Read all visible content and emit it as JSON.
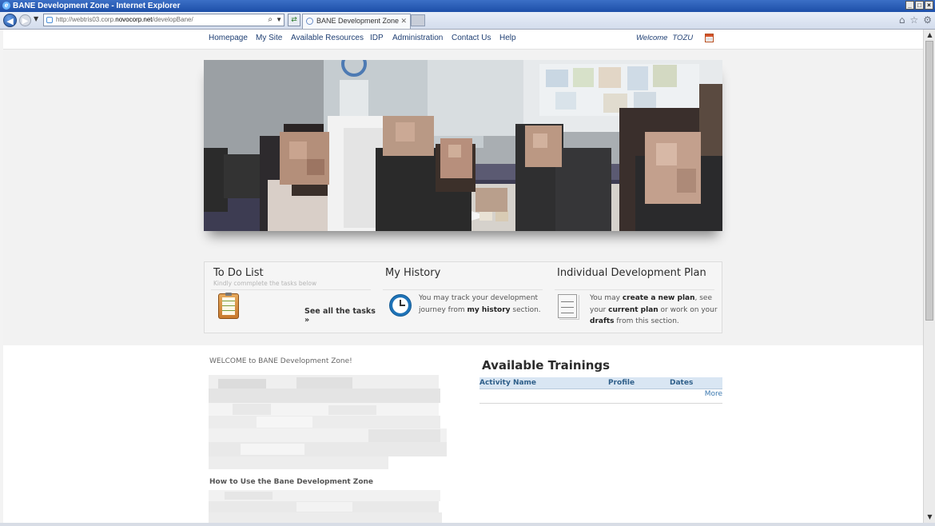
{
  "browser": {
    "window_title": "BANE Development Zone - Internet Explorer",
    "address_prefix": "http://webtris03.corp.",
    "address_host": "novocorp.net",
    "address_path": "/developBane/",
    "tab_title": "BANE Development Zone"
  },
  "nav": {
    "items": [
      "Homepage",
      "My Site",
      "Available Resources",
      "IDP",
      "Administration",
      "Contact Us",
      "Help"
    ],
    "welcome_label": "Welcome",
    "user_name": "TOZU"
  },
  "todo": {
    "title": "To Do List",
    "subtitle": "Kindly commplete the tasks below",
    "link": "See all the tasks »"
  },
  "history": {
    "title": "My History",
    "text_1": "You may track your development journey from ",
    "text_bold": "my history",
    "text_2": " section."
  },
  "idp": {
    "title": "Individual Development Plan",
    "t1": "You may ",
    "b1": "create a new plan",
    "t2": ", see your ",
    "b2": "current plan",
    "t3": " or work on your ",
    "b3": "drafts",
    "t4": " from this section."
  },
  "content": {
    "welcome_heading": "WELCOME to BANE Development Zone!",
    "howto_heading": "How to Use the Bane Development Zone"
  },
  "trainings": {
    "title": "Available Trainings",
    "columns": [
      "Activity Name",
      "Profile",
      "Dates"
    ],
    "more_link": "More"
  },
  "colors": {
    "nav_text": "#1f3f73",
    "table_header_bg": "#d9e6f3",
    "link_blue": "#3c79b0"
  }
}
